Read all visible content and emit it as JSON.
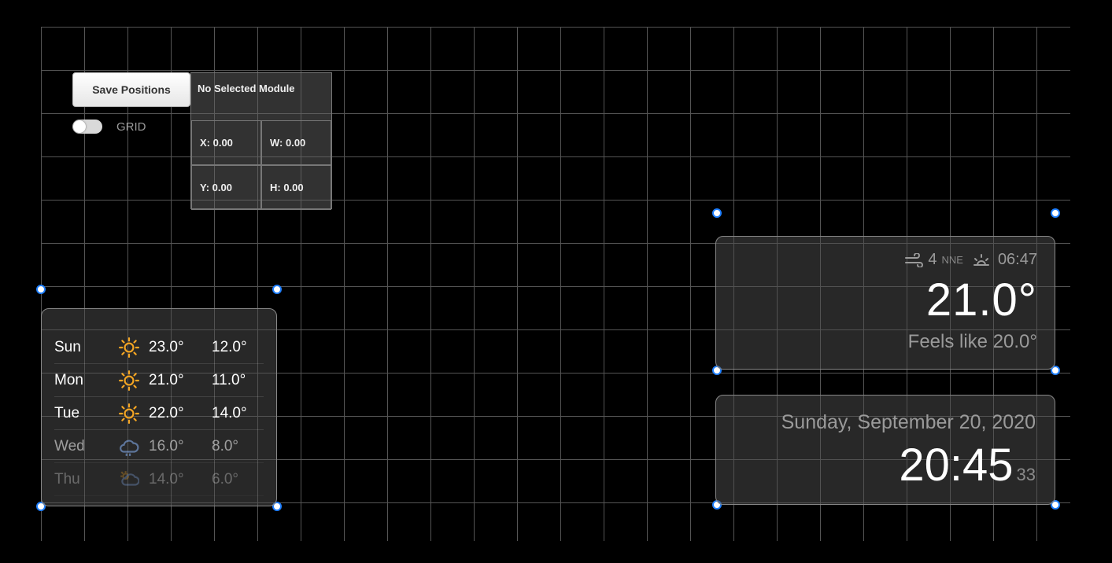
{
  "controls": {
    "save_label": "Save Positions",
    "grid_label": "GRID"
  },
  "info": {
    "title": "No Selected Module",
    "x": "X: 0.00",
    "y": "Y: 0.00",
    "w": "W: 0.00",
    "h": "H: 0.00"
  },
  "forecast": {
    "rows": [
      {
        "day": "Sun",
        "icon": "sun",
        "hi": "23.0°",
        "lo": "12.0°",
        "fade": ""
      },
      {
        "day": "Mon",
        "icon": "sun",
        "hi": "21.0°",
        "lo": "11.0°",
        "fade": ""
      },
      {
        "day": "Tue",
        "icon": "sun",
        "hi": "22.0°",
        "lo": "14.0°",
        "fade": ""
      },
      {
        "day": "Wed",
        "icon": "cloud",
        "hi": "16.0°",
        "lo": "8.0°",
        "fade": "fade1"
      },
      {
        "day": "Thu",
        "icon": "cloudsun",
        "hi": "14.0°",
        "lo": "6.0°",
        "fade": "fade2"
      }
    ]
  },
  "current": {
    "wind_speed": "4",
    "wind_dir": "NNE",
    "sunrise": "06:47",
    "temp": "21.0°",
    "feels": "Feels like 20.0°"
  },
  "clock": {
    "date": "Sunday, September 20, 2020",
    "time": "20:45",
    "seconds": "33"
  }
}
